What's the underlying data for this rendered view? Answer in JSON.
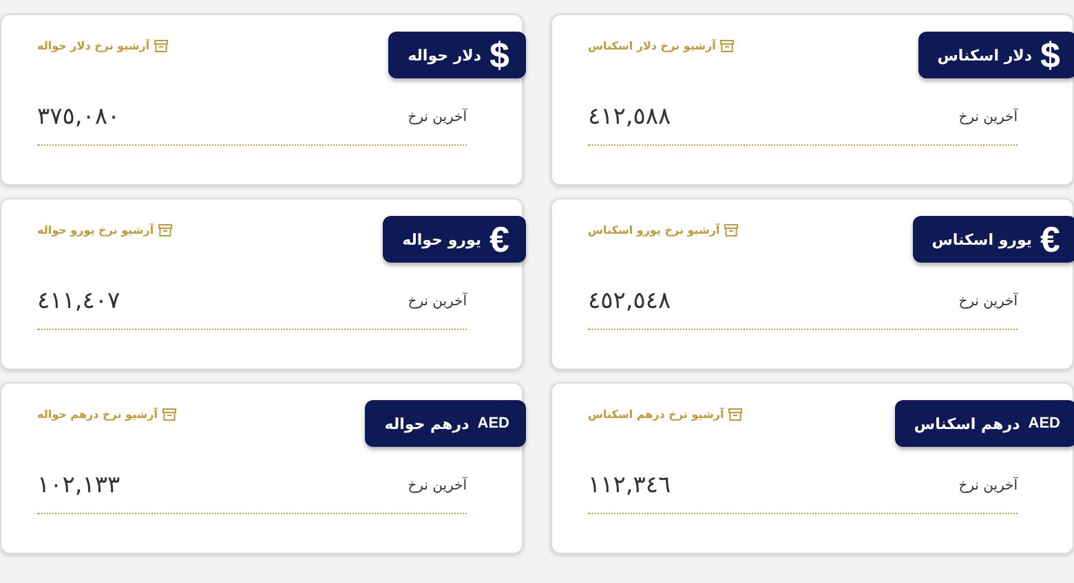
{
  "cards": [
    {
      "symbol": "$",
      "title": "دلار اسکناس",
      "archive_link": "آرشیو نرخ دلار اسکناس",
      "label": "آخرین نرخ",
      "value": "٤١٢,٥٨٨"
    },
    {
      "symbol": "$",
      "title": "دلار حواله",
      "archive_link": "آرشیو نرخ دلار حواله",
      "label": "آخرین نرخ",
      "value": "٣٧٥,٠٨٠"
    },
    {
      "symbol": "€",
      "title": "یورو اسکناس",
      "archive_link": "آرشیو نرخ یورو اسکناس",
      "label": "آخرین نرخ",
      "value": "٤٥٢,٥٤٨"
    },
    {
      "symbol": "€",
      "title": "یورو حواله",
      "archive_link": "آرشیو نرخ یورو حواله",
      "label": "آخرین نرخ",
      "value": "٤١١,٤٠٧"
    },
    {
      "symbol": "AED",
      "title": "درهم اسکناس",
      "archive_link": "آرشیو نرخ درهم اسکناس",
      "label": "آخرین نرخ",
      "value": "١١٢,٣٤٦"
    },
    {
      "symbol": "AED",
      "title": "درهم حواله",
      "archive_link": "آرشیو نرخ درهم حواله",
      "label": "آخرین نرخ",
      "value": "١٠٢,١٣٣"
    }
  ]
}
